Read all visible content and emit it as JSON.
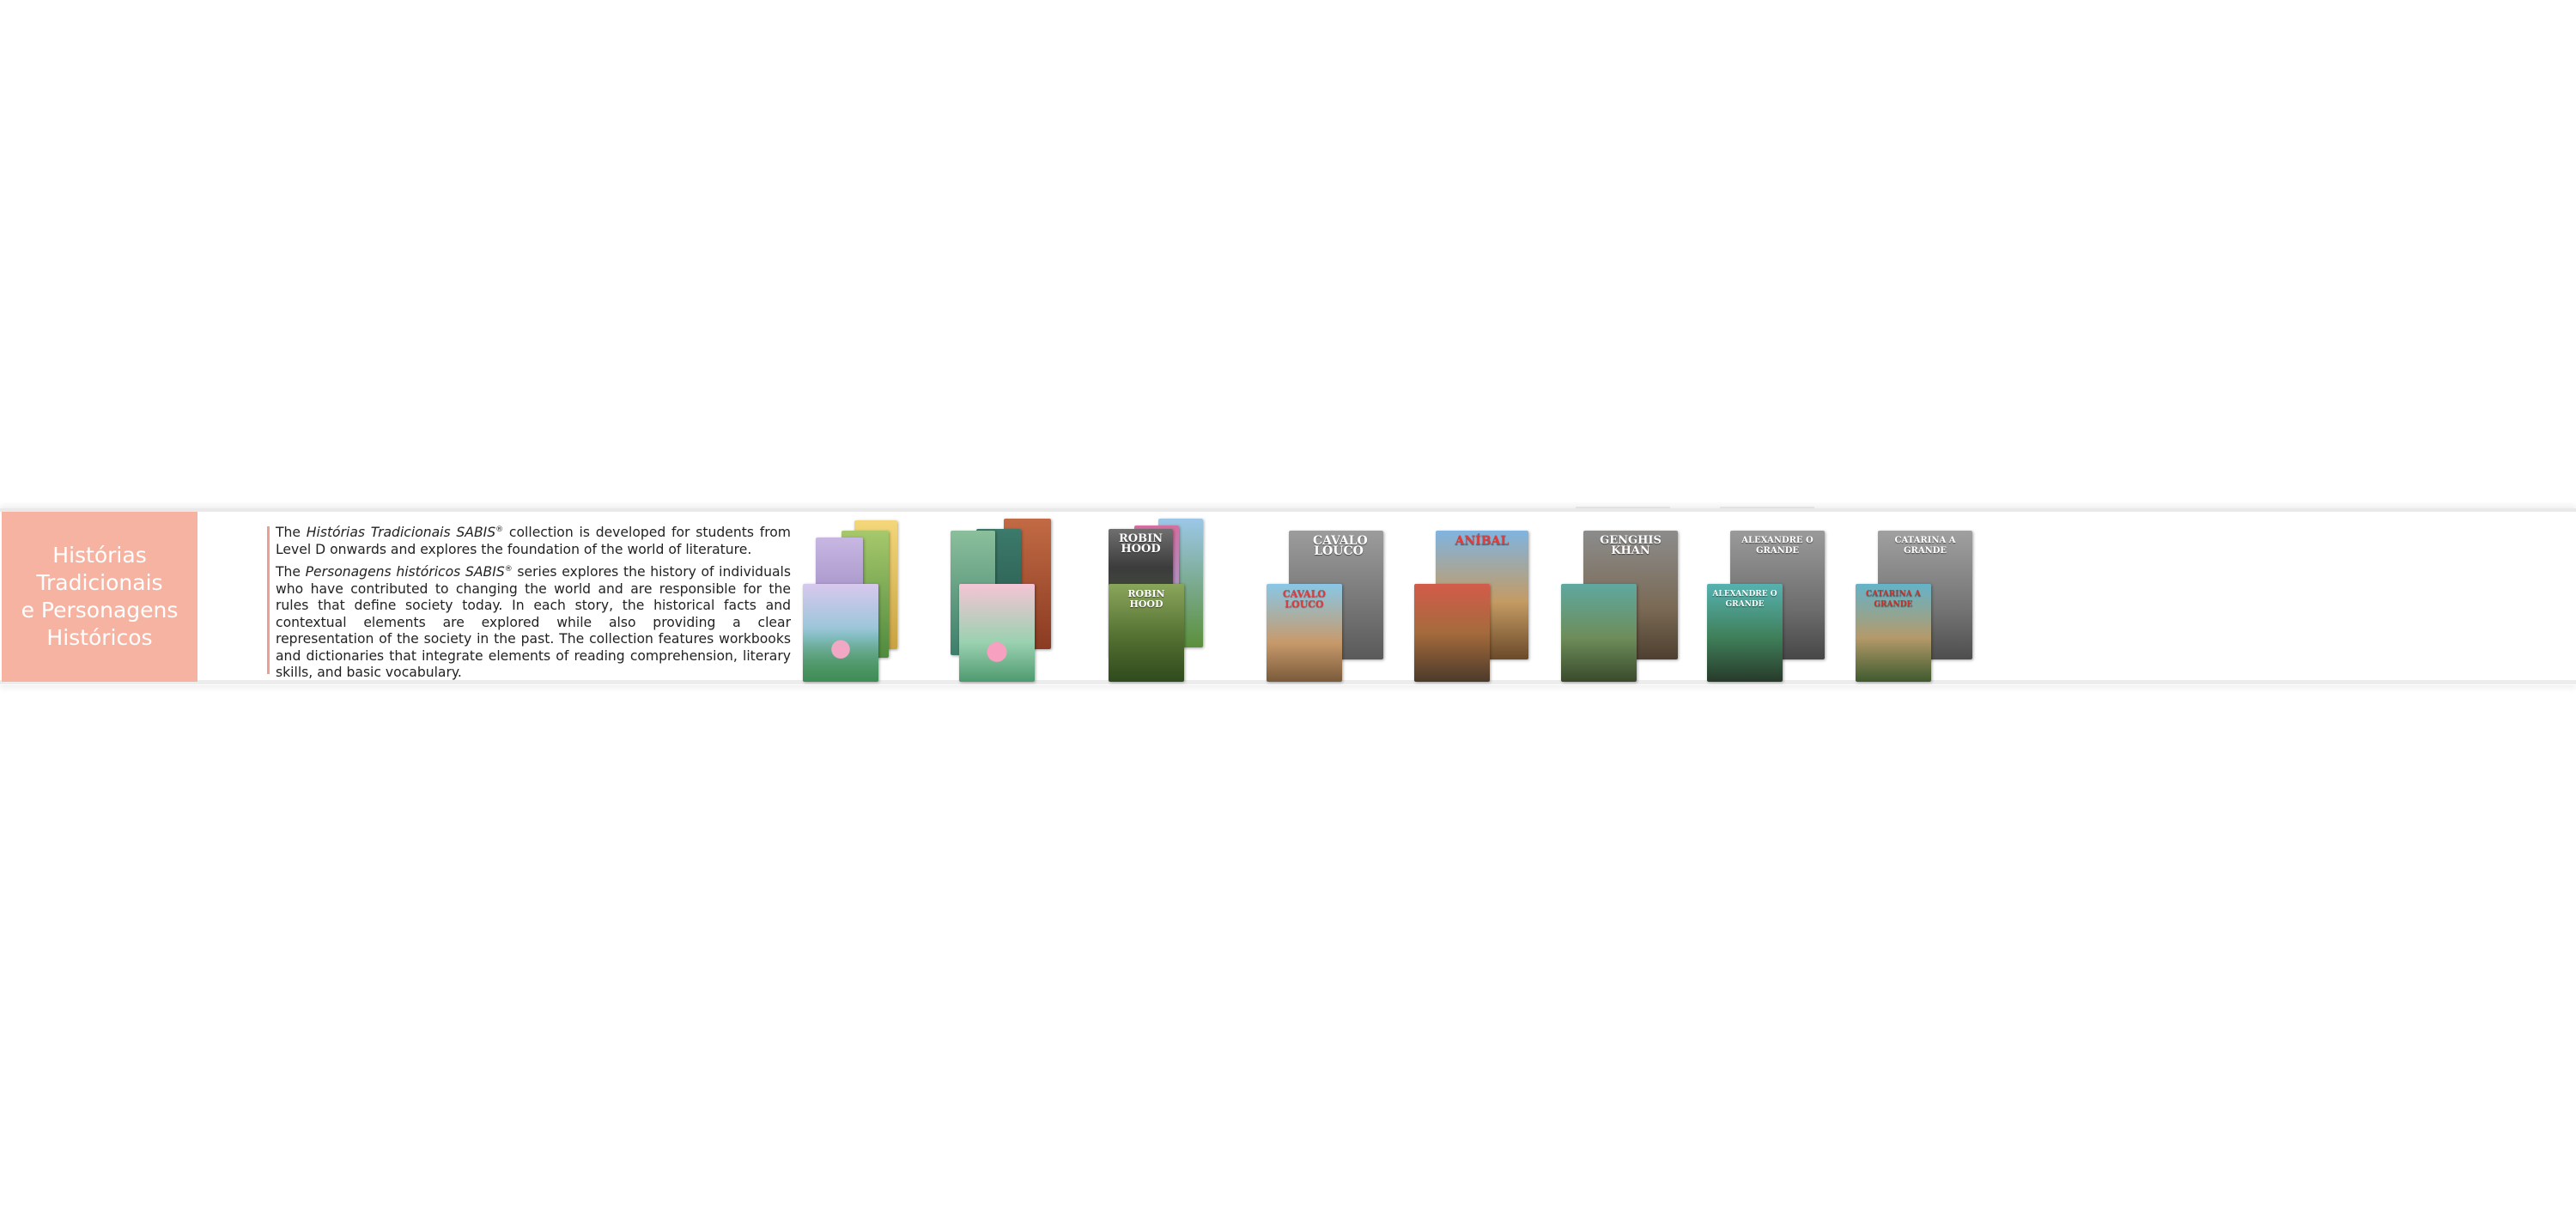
{
  "section": {
    "title_lines": "Histórias\nTradicionais\ne Personagens\nHistóricos",
    "accent_color": "#f7b3a1",
    "divider_color": "#e9a091"
  },
  "description": {
    "p1_a": "The ",
    "p1_em": "Histórias Tradicionais SABIS",
    "p1_sup": "®",
    "p1_b": " collection is developed for students from Level D onwards and explores the foundation of the world of literature.",
    "p2_a": "The ",
    "p2_em": "Personagens históricos SABIS",
    "p2_sup": "®",
    "p2_b": " series explores the history of individuals who have contributed to changing the world and are responsible for the rules that define society today. In each story, the historical facts and contextual elements are explored while also providing a clear representation of the society in the past. The collection features workbooks and dictionaries that integrate elements of reading comprehension, literary skills, and basic vocabulary."
  },
  "books": {
    "robin_hood_back": "Robin Hood",
    "robin_hood_front": "Robin Hood",
    "cavalo_back": "Cavalo Louco",
    "cavalo_front": "Cavalo Louco",
    "anibal_back": "Aníbal",
    "genghis_back": "Genghis Khan",
    "alexandre_back": "Alexandre o Grande",
    "alexandre_front": "Alexandre o Grande",
    "catarina_back": "Catarina a Grande",
    "catarina_front": "Catarina a Grande"
  }
}
